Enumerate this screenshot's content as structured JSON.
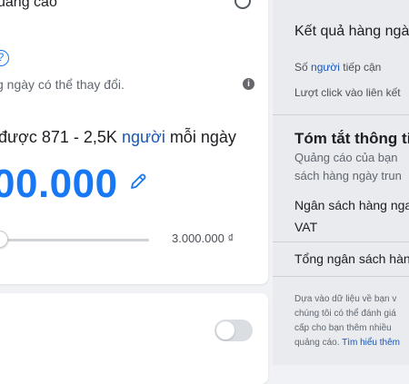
{
  "budget_card": {
    "header_label": "uảng cáo",
    "help_glyph": "?",
    "note": "g ngày có thể thay đổi.",
    "info_glyph": "i",
    "reach_prefix": "được 871 - 2,5K ",
    "reach_link": "người",
    "reach_suffix": " mỗi ngày",
    "budget_amount": "00.000",
    "slider_max": "3.000.000 ₫",
    "slider_position_fraction": 0.0
  },
  "second_card": {
    "toggle_on": false
  },
  "results_panel": {
    "title": "Kết quả hàng ngà",
    "reach_label_prefix": "Số ",
    "reach_label_link": "người",
    "reach_label_suffix": " tiếp cận",
    "clicks_label": "Lượt click vào liên kết",
    "summary_title": "Tóm tắt thông tin",
    "summary_line1": "Quảng cáo của bạn",
    "summary_line2": "sách hàng ngày trun",
    "daily_budget_label": "Ngân sách hàng nga",
    "vat_label": "VAT",
    "total_budget_label": "Tổng ngân sách hàn",
    "footer_line1": "Dựa vào dữ liệu về bạn v",
    "footer_line2": "chúng tôi có thể đánh giá",
    "footer_line3": "cấp cho bạn thêm nhiều",
    "footer_line4_text": "quảng cáo. ",
    "footer_link": "Tìm hiểu thêm"
  },
  "colors": {
    "accent_blue": "#1877f2",
    "link_blue": "#1a56b5",
    "page_bg": "#f0f2f5",
    "panel_bg": "#e9ebee"
  },
  "icons": {
    "edit": "pencil-icon",
    "help": "question-circle-icon",
    "info": "info-circle-icon"
  }
}
